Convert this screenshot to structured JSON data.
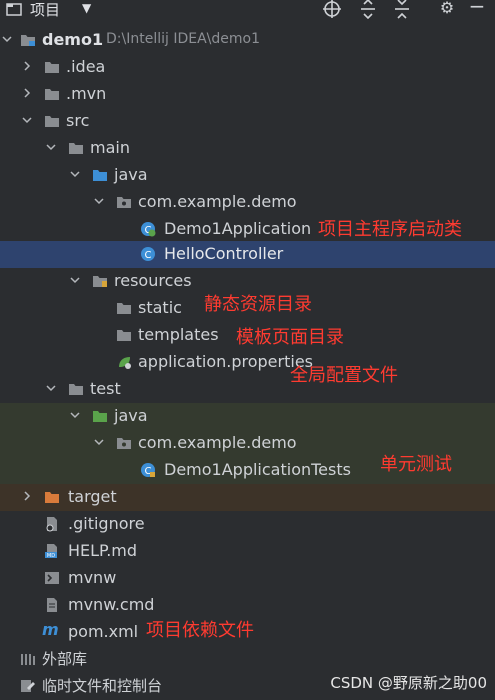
{
  "toolbar": {
    "title": "项目",
    "icons": [
      "project-icon",
      "caret-down-icon",
      "locate-icon",
      "expand-all-icon",
      "collapse-all-icon",
      "gear-icon",
      "hide-icon"
    ]
  },
  "tree": {
    "root": {
      "name": "demo1",
      "path": "D:\\Intellij IDEA\\demo1"
    },
    "idea": ".idea",
    "mvn": ".mvn",
    "src": "src",
    "main": "main",
    "java": "java",
    "pkg": "com.example.demo",
    "app": "Demo1Application",
    "controller": "HelloController",
    "resources": "resources",
    "static": "static",
    "templates": "templates",
    "props": "application.properties",
    "test": "test",
    "test_java": "java",
    "test_pkg": "com.example.demo",
    "tests": "Demo1ApplicationTests",
    "target": "target",
    "gitignore": ".gitignore",
    "help": "HELP.md",
    "mvnw": "mvnw",
    "mvnwcmd": "mvnw.cmd",
    "pom": "pom.xml",
    "extlib": "外部库",
    "scratches": "临时文件和控制台"
  },
  "annotations": {
    "app": "项目主程序启动类",
    "static": "静态资源目录",
    "templates": "模板页面目录",
    "props": "全局配置文件",
    "tests": "单元测试",
    "pom": "项目依赖文件"
  },
  "watermark": "CSDN @野原新之助00",
  "colors": {
    "background": "#2b2d30",
    "selection": "#2e436e",
    "annotation": "#ff3b30",
    "folder": "#8a8d91",
    "source_folder": "#3d8fd6",
    "test_folder": "#5aa34b",
    "target_folder": "#d97b3b"
  }
}
